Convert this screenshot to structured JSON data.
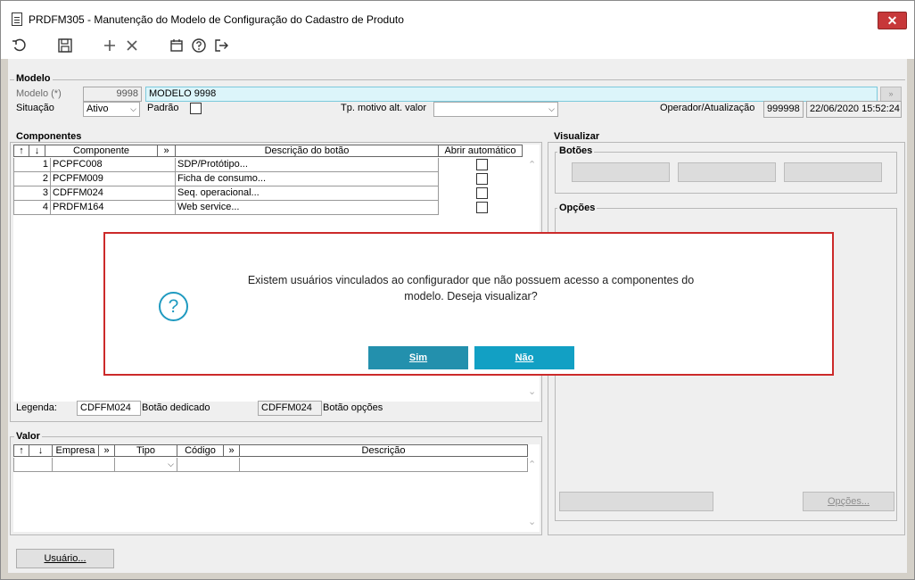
{
  "window": {
    "title": "PRDFM305 - Manutenção do Modelo de Configuração do Cadastro de Produto",
    "close_label": "✕"
  },
  "toolbar": {
    "icons": [
      "undo-icon",
      "save-icon",
      "add-icon",
      "delete-icon",
      "calendar-icon",
      "help-icon",
      "exit-icon"
    ]
  },
  "modelo": {
    "group_label": "Modelo",
    "modelo_label": "Modelo (*)",
    "modelo_code": "9998",
    "modelo_name": "MODELO 9998",
    "situacao_label": "Situação",
    "situacao_value": "Ativo",
    "padrao_label": "Padrão",
    "tp_motivo_label": "Tp. motivo alt. valor",
    "tp_motivo_value": "",
    "operador_label": "Operador/Atualização",
    "operador_value": "999998",
    "atualizacao_value": "22/06/2020 15:52:24"
  },
  "componentes": {
    "group_label": "Componentes",
    "headers": {
      "up": "↑",
      "down": "↓",
      "componente": "Componente",
      "more": "»",
      "descricao": "Descrição do botão",
      "abrir": "Abrir automático"
    },
    "rows": [
      {
        "seq": "1",
        "componente": "PCPFC008",
        "descricao": "SDP/Protótipo...",
        "abrir": false
      },
      {
        "seq": "2",
        "componente": "PCPFM009",
        "descricao": "Ficha de consumo...",
        "abrir": false
      },
      {
        "seq": "3",
        "componente": "CDFFM024",
        "descricao": "Seq. operacional...",
        "abrir": false
      },
      {
        "seq": "4",
        "componente": "PRDFM164",
        "descricao": "Web service...",
        "abrir": false
      }
    ],
    "legenda_label": "Legenda:",
    "legenda_dedicado_value": "CDFFM024",
    "legenda_dedicado_label": "Botão dedicado",
    "legenda_opcoes_value": "CDFFM024",
    "legenda_opcoes_label": "Botão opções"
  },
  "valor": {
    "group_label": "Valor",
    "headers": {
      "up": "↑",
      "down": "↓",
      "empresa": "Empresa",
      "more1": "»",
      "tipo": "Tipo",
      "codigo": "Código",
      "more2": "»",
      "descricao": "Descrição"
    }
  },
  "visualizar": {
    "group_label": "Visualizar",
    "botoes_label": "Botões",
    "opcoes_label": "Opções",
    "opcoes_button": "Opções..."
  },
  "footer": {
    "usuario_button": "Usuário..."
  },
  "dialog": {
    "message_line1": "Existem usuários vinculados ao configurador que não possuem acesso a componentes do",
    "message_line2": "modelo. Deseja visualizar?",
    "icon_glyph": "?",
    "yes_label": "Sim",
    "no_label": "Não",
    "yes_color": "#2390ad",
    "no_color": "#12a0c4"
  }
}
